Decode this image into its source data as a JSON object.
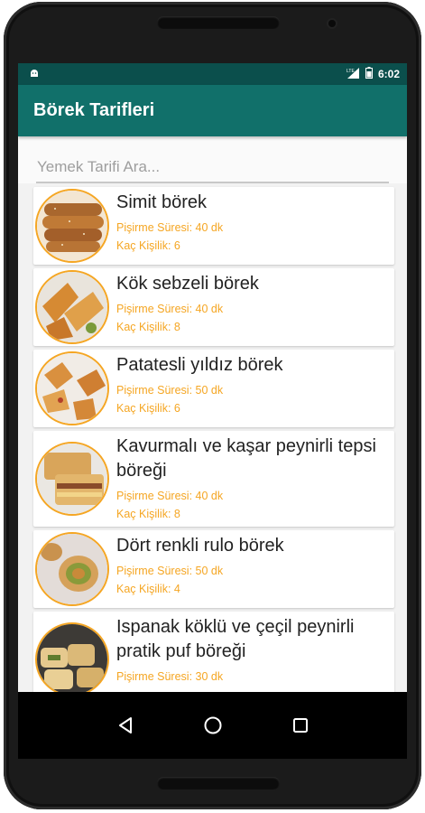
{
  "status": {
    "time": "6:02",
    "network": "LTE"
  },
  "appbar": {
    "title": "Börek Tarifleri"
  },
  "search": {
    "placeholder": "Yemek Tarifi Ara..."
  },
  "colors": {
    "primary": "#11706A",
    "primary_dark": "#0B4F4C",
    "accent": "#F5A623"
  },
  "recipes": [
    {
      "title": "Simit börek",
      "cook_time": "Pişirme Süresi: 40 dk",
      "servings": "Kaç Kişilik: 6"
    },
    {
      "title": "Kök sebzeli börek",
      "cook_time": "Pişirme Süresi: 40 dk",
      "servings": "Kaç Kişilik: 8"
    },
    {
      "title": "Patatesli yıldız börek",
      "cook_time": "Pişirme Süresi: 50 dk",
      "servings": "Kaç Kişilik: 6"
    },
    {
      "title": "Kavurmalı ve kaşar peynirli tepsi böreği",
      "cook_time": "Pişirme Süresi: 40 dk",
      "servings": "Kaç Kişilik: 8"
    },
    {
      "title": "Dört renkli rulo börek",
      "cook_time": "Pişirme Süresi: 50 dk",
      "servings": "Kaç Kişilik: 4"
    },
    {
      "title": "Ispanak köklü ve çeçil peynirli pratik puf böreği",
      "cook_time": "Pişirme Süresi: 30 dk",
      "servings": ""
    }
  ],
  "navbar": {
    "icons": [
      "back-icon",
      "home-icon",
      "recents-icon"
    ]
  }
}
